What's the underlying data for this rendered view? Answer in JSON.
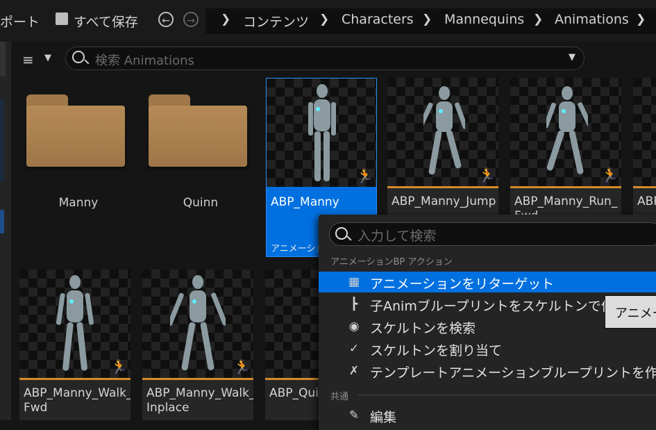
{
  "toolbar": {
    "import_label": "ポート",
    "save_all_label": "すべて保存",
    "back_icon": "arrow-left-icon",
    "forward_icon": "arrow-right-icon"
  },
  "breadcrumb": [
    "コンテンツ",
    "Characters",
    "Mannequins",
    "Animations"
  ],
  "search": {
    "placeholder": "検索 Animations"
  },
  "assets": [
    {
      "name": "Manny",
      "kind": "folder"
    },
    {
      "name": "Quinn",
      "kind": "folder"
    },
    {
      "name": "ABP_Manny",
      "kind": "anim_blueprint",
      "type_label": "アニメーショ",
      "selected": true
    },
    {
      "name": "ABP_Manny_Jump",
      "kind": "animation"
    },
    {
      "name": "ABP_Manny_Run_\nFwd",
      "kind": "animation"
    },
    {
      "name": "ABP_",
      "kind": "animation"
    },
    {
      "name": "ABP_Manny_Walk_\nFwd",
      "kind": "animation"
    },
    {
      "name": "ABP_Manny_Walk_\nInplace",
      "kind": "animation"
    },
    {
      "name": "ABP_Qui",
      "kind": "animation"
    }
  ],
  "context_menu": {
    "search_placeholder": "入力して検索",
    "section_anim_bp": "アニメーションBP アクション",
    "items": [
      {
        "label": "アニメーションをリターゲット",
        "icon": "retarget-grid-icon",
        "highlighted": true
      },
      {
        "label": "子Animブループリントをスケルトンで作",
        "icon": "hierarchy-icon"
      },
      {
        "label": "スケルトンを検索",
        "icon": "magnify-circle-icon"
      },
      {
        "label": "スケルトンを割り当て",
        "icon": "assign-skeleton-icon"
      },
      {
        "label": "テンプレートアニメーションブループリントを作成",
        "icon": "template-figure-icon"
      }
    ],
    "section_common": "共通",
    "edit_label": "編集"
  },
  "tooltip": {
    "text": "アニメー"
  },
  "colors": {
    "selection": "#0070e0",
    "highlight": "#0070e0",
    "asset_underline": "#d68a2a",
    "folder": "#b58a56"
  }
}
